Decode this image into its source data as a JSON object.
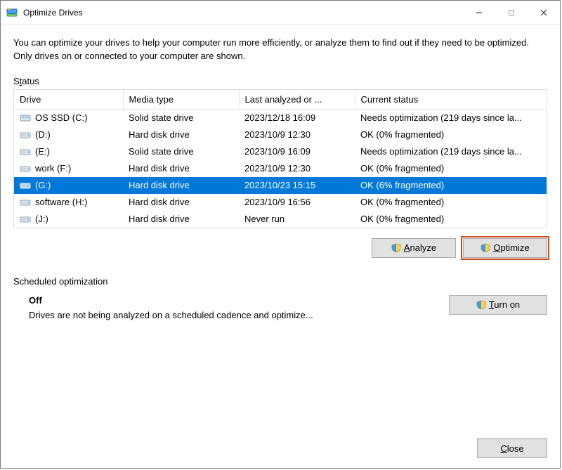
{
  "window": {
    "title": "Optimize Drives"
  },
  "intro": "You can optimize your drives to help your computer run more efficiently, or analyze them to find out if they need to be optimized. Only drives on or connected to your computer are shown.",
  "status_label": {
    "prefix": "S",
    "underlined": "t",
    "suffix": "atus"
  },
  "columns": {
    "drive": "Drive",
    "media": "Media type",
    "last": "Last analyzed or ...",
    "status": "Current status"
  },
  "drives": [
    {
      "icon": "ssd",
      "name": "OS SSD (C:)",
      "media": "Solid state drive",
      "last": "2023/12/18 16:09",
      "status": "Needs optimization (219 days since la...",
      "selected": false
    },
    {
      "icon": "hdd",
      "name": "(D:)",
      "media": "Hard disk drive",
      "last": "2023/10/9 12:30",
      "status": "OK (0% fragmented)",
      "selected": false
    },
    {
      "icon": "hdd",
      "name": "(E:)",
      "media": "Solid state drive",
      "last": "2023/10/9 16:09",
      "status": "Needs optimization (219 days since la...",
      "selected": false
    },
    {
      "icon": "hdd",
      "name": "work (F:)",
      "media": "Hard disk drive",
      "last": "2023/10/9 12:30",
      "status": "OK (0% fragmented)",
      "selected": false
    },
    {
      "icon": "hdd",
      "name": "(G:)",
      "media": "Hard disk drive",
      "last": "2023/10/23 15:15",
      "status": "OK (6% fragmented)",
      "selected": true
    },
    {
      "icon": "hdd",
      "name": "software (H:)",
      "media": "Hard disk drive",
      "last": "2023/10/9 16:56",
      "status": "OK (0% fragmented)",
      "selected": false
    },
    {
      "icon": "hdd",
      "name": "(J:)",
      "media": "Hard disk drive",
      "last": "Never run",
      "status": "OK (0% fragmented)",
      "selected": false
    }
  ],
  "buttons": {
    "analyze": {
      "before": "",
      "ul": "A",
      "after": "nalyze"
    },
    "optimize": {
      "before": "",
      "ul": "O",
      "after": "ptimize"
    },
    "turn_on": {
      "before": "",
      "ul": "T",
      "after": "urn on"
    },
    "close": {
      "before": "",
      "ul": "C",
      "after": "lose"
    }
  },
  "schedule": {
    "label": "Scheduled optimization",
    "state": "Off",
    "desc": "Drives are not being analyzed on a scheduled cadence and optimize..."
  },
  "colors": {
    "selection": "#0078d7",
    "highlight_outline": "#c84b1e"
  }
}
